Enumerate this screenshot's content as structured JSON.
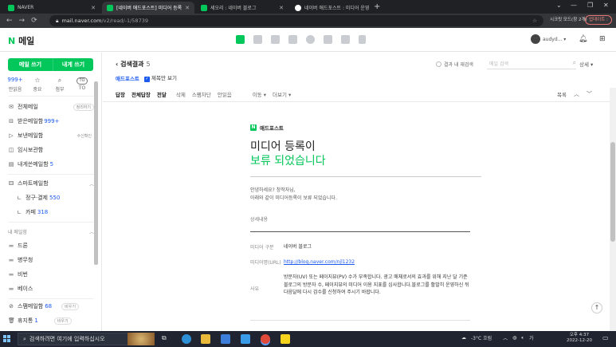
{
  "browser": {
    "tabs": [
      {
        "label": "NAVER",
        "active": false
      },
      {
        "label": "[네이버 애드포스트] 미디어 등록",
        "active": true
      },
      {
        "label": "세오리 : 네이버 블로그",
        "active": false
      },
      {
        "label": "네이버 애드포스트 : 미디어 운영",
        "active": false
      }
    ],
    "url_host": "mail.naver.com",
    "url_path": "/v2/read/-1/58739",
    "secret_mode": "시크릿 모드(창 2개)",
    "update_label": "업데이트 :"
  },
  "header": {
    "logo_n": "N",
    "logo_text": "메일",
    "user_name": "audyd... ▾"
  },
  "sidebar": {
    "compose": "메일 쓰기",
    "to_me": "내게 쓰기",
    "stats": [
      {
        "top": "999+",
        "label": "안읽음"
      },
      {
        "top": "☆",
        "label": "중요"
      },
      {
        "top": "⌕",
        "label": "첨부"
      },
      {
        "top": "TO",
        "label": "TO"
      }
    ],
    "items": [
      {
        "icon": "✉",
        "label": "전체메일",
        "pill": "정리하기"
      },
      {
        "icon": "⊟",
        "label": "받은메일함",
        "count": "999+"
      },
      {
        "icon": "▷",
        "label": "보낸메일함",
        "pill": "수신확인"
      },
      {
        "icon": "◫",
        "label": "임시보관함"
      },
      {
        "icon": "▤",
        "label": "내게쓴메일함",
        "count": "5"
      }
    ],
    "smart": {
      "icon": "⚃",
      "label": "스마트메일함"
    },
    "smart_subs": [
      {
        "label": "정구·결제",
        "count": "550"
      },
      {
        "label": "카페",
        "count": "318"
      }
    ],
    "my_label": "내 메일함",
    "my_folders": [
      "드론",
      "병무청",
      "비번",
      "베이스"
    ],
    "spam": {
      "label": "스팸메일함",
      "count": "68",
      "pill": "비우기"
    },
    "trash": {
      "label": "휴지통",
      "count": "1",
      "pill": "비우기"
    }
  },
  "list": {
    "back_label": "‹ 검색결과",
    "back_count": "5",
    "keyword": "애드포스트",
    "subject_only": "제목만 보기",
    "within_results": "결과 내 재검색",
    "search_placeholder": "메일 검색",
    "detail": "상세 ▾",
    "tools_bold": [
      "답장",
      "전체답장",
      "전달"
    ],
    "tools_normal": [
      "삭제",
      "스팸차단",
      "안읽음"
    ],
    "tools_drop": [
      "이동 ▾",
      "더보기 ▾"
    ],
    "list_btn": "목록"
  },
  "message": {
    "brand": "애드포스트",
    "title1": "미디어 등록이",
    "title2": "보류 되었습니다",
    "greeting1": "안녕하세요? 창작자님,",
    "greeting2": "아래와 같이 미디어등록이 보류 되었습니다.",
    "detail_title": "상세내용",
    "rows": [
      {
        "k": "미디어 구분",
        "v": "네이버 블로그",
        "link": false
      },
      {
        "k": "미디어명(URL)",
        "v": "http://blog.naver.com/njl1232",
        "link": true
      },
      {
        "k": "사유",
        "v": "방문자(UV) 또는 페이지뷰(PV) 수가 부족합니다. 광고 매체로서의 효과를 위해 지난 달 기준 블로그의 방문자 수, 페이지뷰의 미디어 이용 지표를 심사합니다.블로그를 활발히 운영하신 뒤 다음달에 다시 검수를 신청하여 주시기 바랍니다.",
        "link": false
      }
    ]
  },
  "taskbar": {
    "search_placeholder": "검색하려면 여기에 입력하십시오",
    "weather": "-3°C 흐림",
    "time": "오후 4:37",
    "date": "2022-12-20"
  },
  "colors": {
    "naver_green": "#03c75a",
    "link_blue": "#1b5aef"
  }
}
